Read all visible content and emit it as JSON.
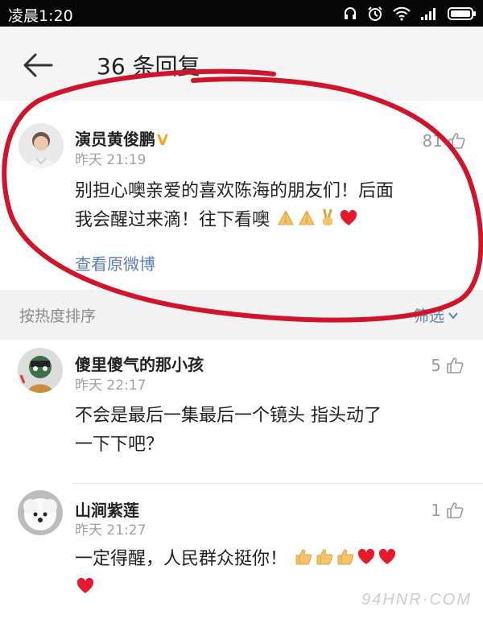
{
  "status_bar": {
    "time": "凌晨1:20",
    "icons": [
      "headphones-icon",
      "alarm-icon",
      "wifi-icon",
      "signal-icon",
      "battery-icon"
    ]
  },
  "header": {
    "title": "36 条回复",
    "back_icon": "back-arrow-icon"
  },
  "post": {
    "author": "演员黄俊鹏",
    "verified_mark": "V",
    "time": "昨天 21:19",
    "likes": "81",
    "text_line1": "别担心噢亲爱的喜欢陈海的朋友们！后面",
    "text_line2": "我会醒过来滴！往下看噢",
    "emojis": [
      "pray",
      "pray",
      "victory",
      "red-heart"
    ],
    "view_original": "查看原微博"
  },
  "sort_bar": {
    "label": "按热度排序",
    "filter": "筛选"
  },
  "comments": [
    {
      "author": "傻里傻气的那小孩",
      "time": "昨天 22:17",
      "likes": "5",
      "text_line1": "不会是最后一集最后一个镜头 指头动了",
      "text_line2": "一下下吧？"
    },
    {
      "author": "山涧紫莲",
      "time": "昨天 21:27",
      "likes": "1",
      "text_line1": "一定得醒，人民群众挺你！",
      "emojis": [
        "thumbs-up",
        "thumbs-up",
        "thumbs-up",
        "red-heart",
        "red-heart",
        "red-heart"
      ]
    }
  ],
  "watermark": "94HNR·COM",
  "colors": {
    "accent": "#5b7fb0",
    "annotation": "#d0142c",
    "verified": "#f5a623"
  }
}
